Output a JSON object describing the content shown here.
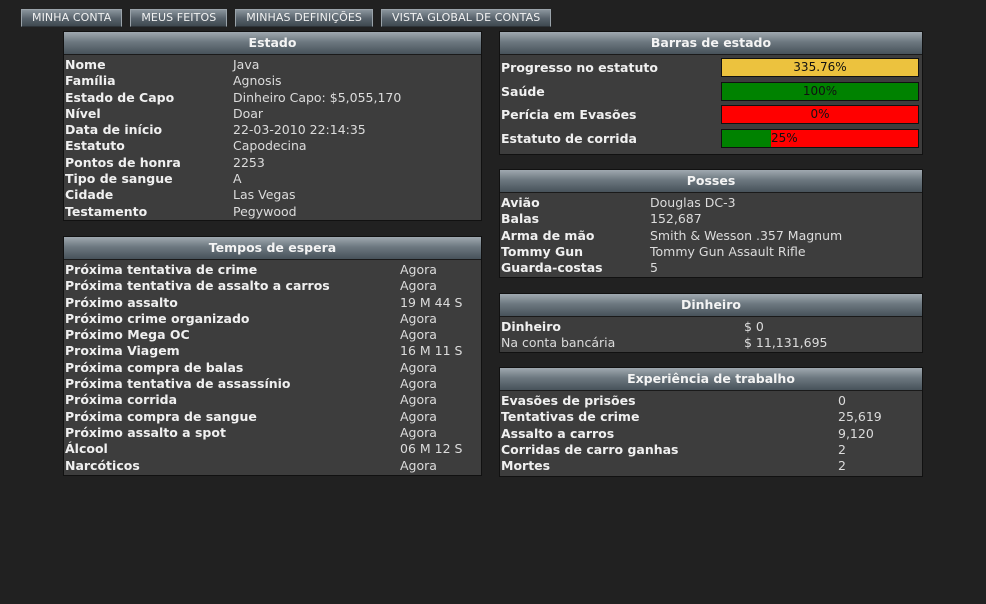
{
  "tabs": [
    "MINHA CONTA",
    "MEUS FEITOS",
    "MINHAS DEFINIÇÕES",
    "VISTA GLOBAL DE CONTAS"
  ],
  "estado": {
    "title": "Estado",
    "rows": [
      {
        "k": "Nome",
        "v": "Java"
      },
      {
        "k": "Família",
        "v": "Agnosis"
      },
      {
        "k": "Estado de Capo",
        "v": "Dinheiro Capo: $5,055,170"
      },
      {
        "k": "Nível",
        "v": "Doar"
      },
      {
        "k": "Data de início",
        "v": "22-03-2010 22:14:35"
      },
      {
        "k": "Estatuto",
        "v": "Capodecina"
      },
      {
        "k": "Pontos de honra",
        "v": "2253"
      },
      {
        "k": "Tipo de sangue",
        "v": "A"
      },
      {
        "k": "Cidade",
        "v": "Las Vegas"
      },
      {
        "k": "Testamento",
        "v": "Pegywood"
      }
    ]
  },
  "tempos": {
    "title": "Tempos de espera",
    "rows": [
      {
        "k": "Próxima tentativa de crime",
        "v": "Agora"
      },
      {
        "k": "Próxima tentativa de assalto a carros",
        "v": "Agora"
      },
      {
        "k": "Próximo assalto",
        "v": "19 M 44 S"
      },
      {
        "k": "Próximo crime organizado",
        "v": "Agora"
      },
      {
        "k": "Próximo Mega OC",
        "v": "Agora"
      },
      {
        "k": "Proxima Viagem",
        "v": "16 M 11 S"
      },
      {
        "k": "Próxima compra de balas",
        "v": "Agora"
      },
      {
        "k": "Próxima tentativa de assassínio",
        "v": "Agora"
      },
      {
        "k": "Próxima corrida",
        "v": "Agora"
      },
      {
        "k": "Próxima compra de sangue",
        "v": "Agora"
      },
      {
        "k": "Próximo assalto a spot",
        "v": "Agora"
      },
      {
        "k": "Álcool",
        "v": "06 M 12 S"
      },
      {
        "k": "Narcóticos",
        "v": "Agora"
      }
    ]
  },
  "barras": {
    "title": "Barras de estado",
    "rows": [
      {
        "k": "Progresso no estatuto",
        "text": "335.76%",
        "fill": 1.0,
        "fill_color": "#ecc23e",
        "text_align": "center"
      },
      {
        "k": "Saúde",
        "text": "100%",
        "fill": 1.0,
        "fill_color": "#008200",
        "text_align": "center"
      },
      {
        "k": "Perícia em Evasões",
        "text": "0%",
        "fill": 0.0,
        "fill_color": "#008200",
        "text_align": "center"
      },
      {
        "k": "Estatuto de corrida",
        "text": "25%",
        "fill": 0.25,
        "fill_color": "#008200",
        "text_align": "after-fill"
      }
    ]
  },
  "posses": {
    "title": "Posses",
    "rows": [
      {
        "k": "Avião",
        "v": "Douglas DC-3"
      },
      {
        "k": "Balas",
        "v": "152,687"
      },
      {
        "k": "Arma de mão",
        "v": "Smith & Wesson .357 Magnum"
      },
      {
        "k": "Tommy Gun",
        "v": "Tommy Gun Assault Rifle"
      },
      {
        "k": "Guarda-costas",
        "v": "5"
      }
    ]
  },
  "dinheiro": {
    "title": "Dinheiro",
    "rows": [
      {
        "k": "Dinheiro",
        "v": "$ 0",
        "bold": true
      },
      {
        "k": "Na conta bancária",
        "v": "$ 11,131,695",
        "bold": false
      }
    ]
  },
  "experiencia": {
    "title": "Experiência de trabalho",
    "rows": [
      {
        "k": "Evasões de prisões",
        "v": "0"
      },
      {
        "k": "Tentativas de crime",
        "v": "25,619"
      },
      {
        "k": "Assalto a carros",
        "v": "9,120"
      },
      {
        "k": "Corridas de carro ganhas",
        "v": "2"
      },
      {
        "k": "Mortes",
        "v": "2"
      }
    ]
  }
}
